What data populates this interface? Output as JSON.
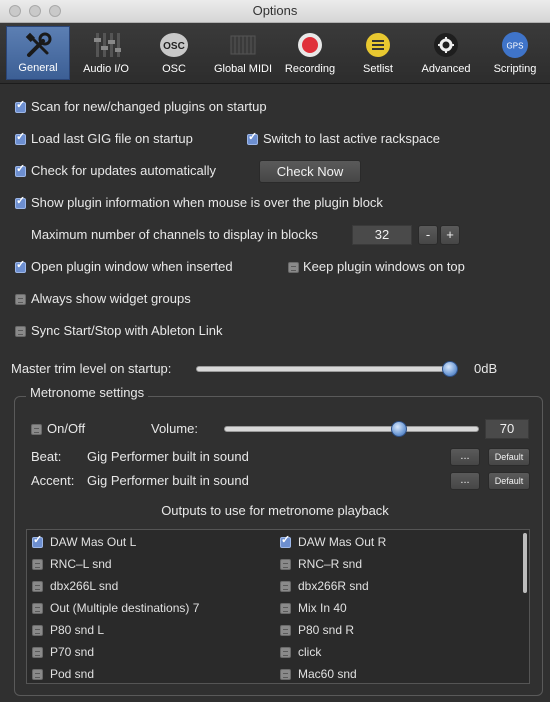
{
  "window": {
    "title": "Options"
  },
  "toolbar": [
    {
      "label": "General",
      "icon": "tools-icon",
      "active": true
    },
    {
      "label": "Audio I/O",
      "icon": "mixer-faders-icon",
      "active": false
    },
    {
      "label": "OSC",
      "icon": "osc-icon",
      "active": false
    },
    {
      "label": "Global MIDI",
      "icon": "piano-keys-icon",
      "active": false
    },
    {
      "label": "Recording",
      "icon": "record-icon",
      "active": false
    },
    {
      "label": "Setlist",
      "icon": "setlist-icon",
      "active": false
    },
    {
      "label": "Advanced",
      "icon": "gear-icon",
      "active": false
    },
    {
      "label": "Scripting",
      "icon": "gps-script-icon",
      "active": false
    }
  ],
  "osc_icon_text": "OSC",
  "gps_icon_text": "GPS",
  "general": {
    "scan_plugins": {
      "label": "Scan for new/changed plugins on startup",
      "checked": true
    },
    "load_last_gig": {
      "label": "Load last GIG file on startup",
      "checked": true
    },
    "switch_last_rackspace": {
      "label": "Switch to last active rackspace",
      "checked": true
    },
    "check_updates": {
      "label": "Check for updates automatically",
      "checked": true
    },
    "check_now_label": "Check Now",
    "show_plugin_info": {
      "label": "Show plugin information when mouse is over the plugin block",
      "checked": true
    },
    "max_channels_label": "Maximum number of channels to display in blocks",
    "max_channels_value": "32",
    "minus_label": "-",
    "plus_label": "+",
    "open_plugin_window": {
      "label": "Open plugin window when inserted",
      "checked": true
    },
    "keep_on_top": {
      "label": "Keep plugin windows on top",
      "checked": false
    },
    "always_widget_groups": {
      "label": "Always show widget groups",
      "checked": false
    },
    "sync_ableton": {
      "label": "Sync Start/Stop with Ableton Link",
      "checked": false
    },
    "master_trim_label": "Master trim level on startup:",
    "master_trim_value": "0dB",
    "master_trim_level": 1.0
  },
  "metronome": {
    "title": "Metronome settings",
    "on_off": {
      "label": "On/Off",
      "checked": false
    },
    "volume_label": "Volume:",
    "volume_value": "70",
    "volume_level": 0.7,
    "beat_label": "Beat:",
    "beat_value": "Gig Performer built in sound",
    "accent_label": "Accent:",
    "accent_value": "Gig Performer built in sound",
    "browse_label": "...",
    "default_label": "Default",
    "outputs_title": "Outputs to use for metronome playback",
    "outputs_left": [
      {
        "label": "DAW Mas Out L",
        "checked": true
      },
      {
        "label": "RNC–L snd",
        "checked": false
      },
      {
        "label": "dbx266L snd",
        "checked": false
      },
      {
        "label": "Out (Multiple destinations) 7",
        "checked": false
      },
      {
        "label": "P80 snd L",
        "checked": false
      },
      {
        "label": "P70 snd",
        "checked": false
      },
      {
        "label": "Pod snd",
        "checked": false
      }
    ],
    "outputs_right": [
      {
        "label": "DAW Mas Out R",
        "checked": true
      },
      {
        "label": "RNC–R snd",
        "checked": false
      },
      {
        "label": "dbx266R snd",
        "checked": false
      },
      {
        "label": "Mix In 40",
        "checked": false
      },
      {
        "label": "P80 snd R",
        "checked": false
      },
      {
        "label": "click",
        "checked": false
      },
      {
        "label": "Mac60 snd",
        "checked": false
      }
    ]
  },
  "colors": {
    "active_tab": "#4a6ea6",
    "record": "#e0303a",
    "setlist": "#e8c830",
    "scripting": "#3f74c9",
    "checkbox": "#6d8fd0"
  }
}
